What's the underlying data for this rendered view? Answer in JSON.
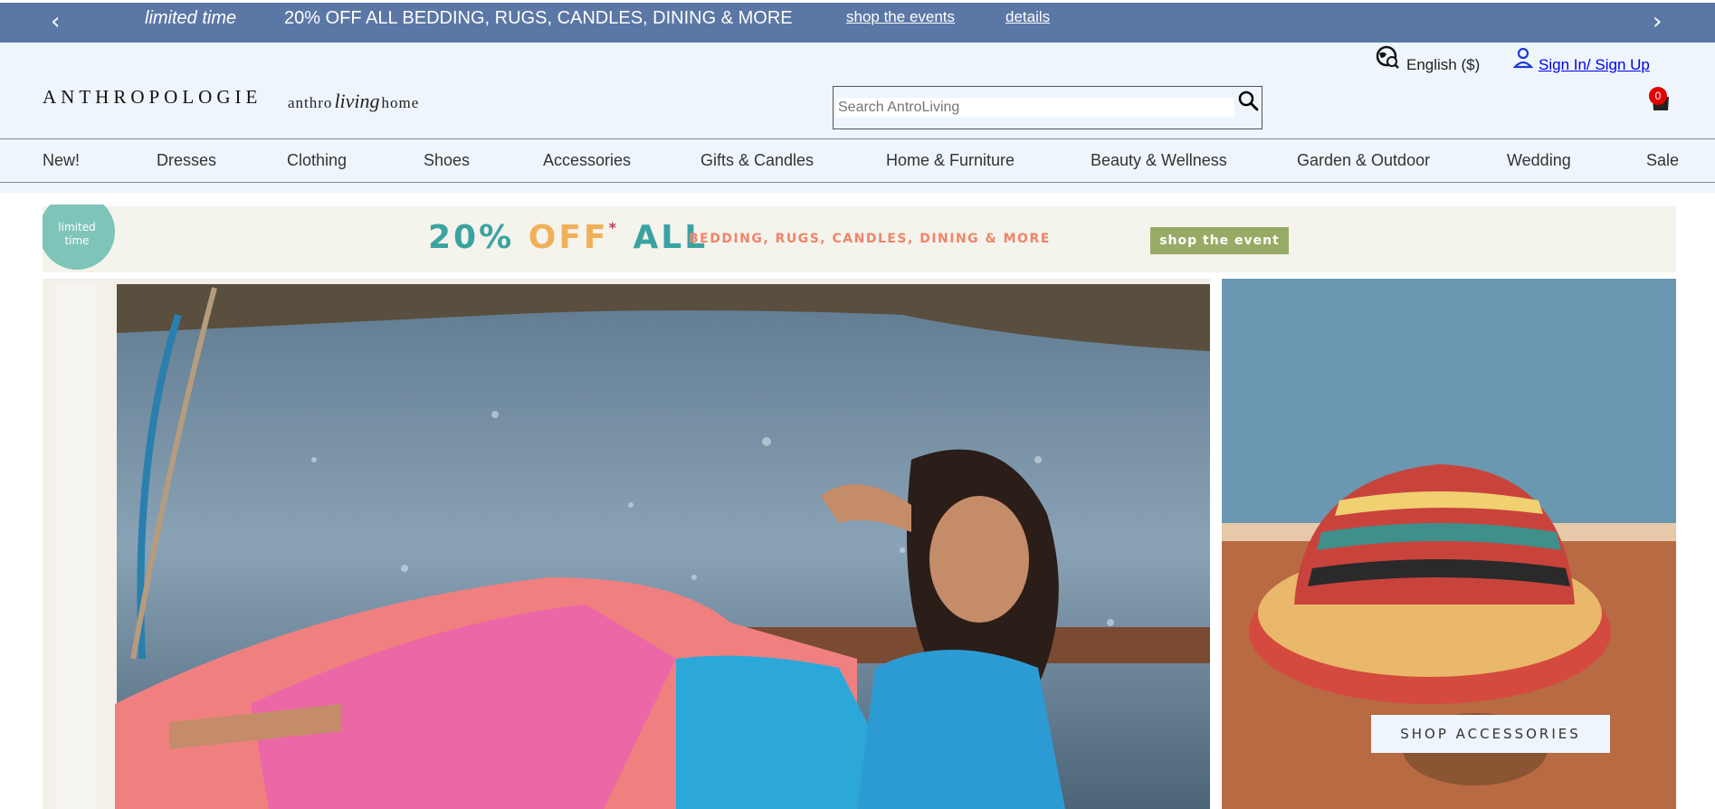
{
  "promo": {
    "limited_time": "limited time",
    "message": "20% OFF ALL BEDDING, RUGS, CANDLES, DINING & MORE",
    "shop_link": "shop the events",
    "details_link": "details",
    "prev_icon": "chevron-left-icon",
    "next_icon": "chevron-right-icon",
    "background": "#5b77a5"
  },
  "header": {
    "logo": "ANTHROPOLOGIE",
    "sublogo_left": "anthro",
    "sublogo_script": "living",
    "sublogo_right": "home",
    "search_placeholder": "Search AntroLiving",
    "language": "English ($)",
    "signin": "Sign In/ Sign Up",
    "cart_count": "0",
    "background": "#eef5fc"
  },
  "nav": {
    "items": [
      "New!",
      "Dresses",
      "Clothing",
      "Shoes",
      "Accessories",
      "Gifts & Candles",
      "Home & Furniture",
      "Beauty & Wellness",
      "Garden & Outdoor",
      "Wedding",
      "Sale"
    ]
  },
  "event_banner": {
    "badge_line1": "limited",
    "badge_line2": "time",
    "off_part1": "20%",
    "off_part2": "OFF",
    "off_asterisk": "*",
    "off_part3": "ALL",
    "categories": "BEDDING, RUGS, CANDLES, DINING & MORE",
    "button": "shop the event"
  },
  "hero": {
    "right_button": "SHOP ACCESSORIES"
  }
}
